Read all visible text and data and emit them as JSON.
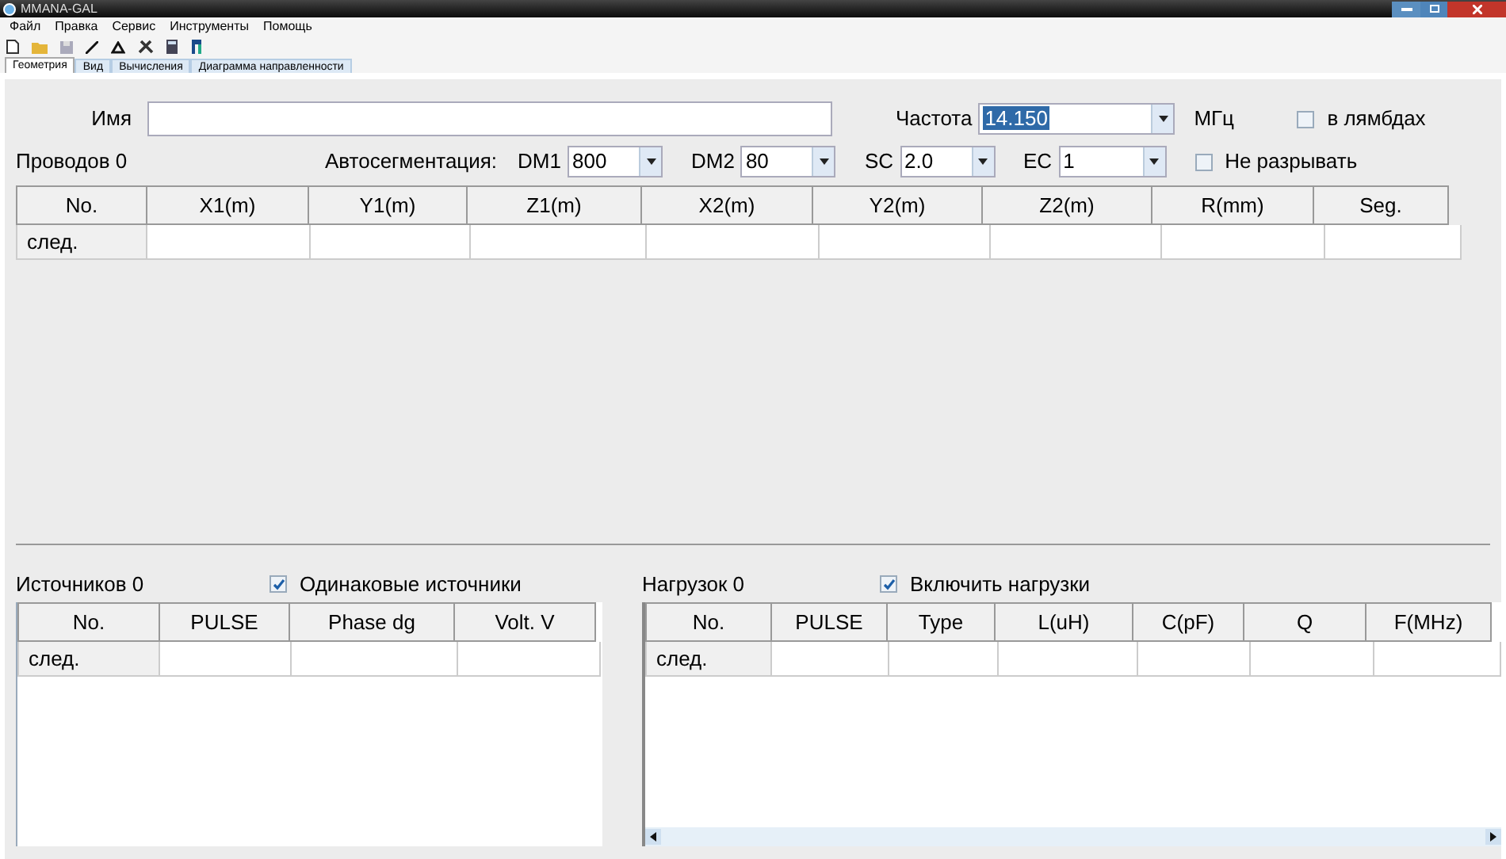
{
  "window": {
    "title": "MMANA-GAL"
  },
  "menu": [
    "Файл",
    "Правка",
    "Сервис",
    "Инструменты",
    "Помощь"
  ],
  "tabs": [
    {
      "label": "Геометрия",
      "selected": true
    },
    {
      "label": "Вид",
      "selected": false
    },
    {
      "label": "Вычисления",
      "selected": false
    },
    {
      "label": "Диаграмма направленности",
      "selected": false
    }
  ],
  "name_field": {
    "label": "Имя"
  },
  "frequency": {
    "label": "Частота",
    "value": "14.150",
    "unit": "МГц"
  },
  "lambda_checkbox": {
    "label": "в лямбдах",
    "checked": false
  },
  "wires_count": "Проводов 0",
  "autoseg": {
    "label": "Автосегментация:",
    "fields": [
      {
        "label": "DM1",
        "value": "800"
      },
      {
        "label": "DM2",
        "value": "80"
      },
      {
        "label": "SC",
        "value": "2.0"
      },
      {
        "label": "EC",
        "value": "1"
      }
    ]
  },
  "nobreak_checkbox": {
    "label": "Не разрывать",
    "checked": false
  },
  "wires_table": {
    "columns": [
      "No.",
      "X1(m)",
      "Y1(m)",
      "Z1(m)",
      "X2(m)",
      "Y2(m)",
      "Z2(m)",
      "R(mm)",
      "Seg."
    ],
    "rows": [
      [
        "след.",
        "",
        "",
        "",
        "",
        "",
        "",
        "",
        ""
      ]
    ]
  },
  "sources": {
    "count": "Источников 0",
    "checkbox": {
      "label": "Одинаковые источники",
      "checked": true
    },
    "columns": [
      "No.",
      "PULSE",
      "Phase dg",
      "Volt. V"
    ],
    "rows": [
      [
        "след.",
        "",
        "",
        ""
      ]
    ]
  },
  "loads": {
    "count": "Нагрузок 0",
    "checkbox": {
      "label": "Включить нагрузки",
      "checked": true
    },
    "columns": [
      "No.",
      "PULSE",
      "Type",
      "L(uH)",
      "C(pF)",
      "Q",
      "F(MHz)"
    ],
    "rows": [
      [
        "след.",
        "",
        "",
        "",
        "",
        "",
        ""
      ]
    ]
  }
}
